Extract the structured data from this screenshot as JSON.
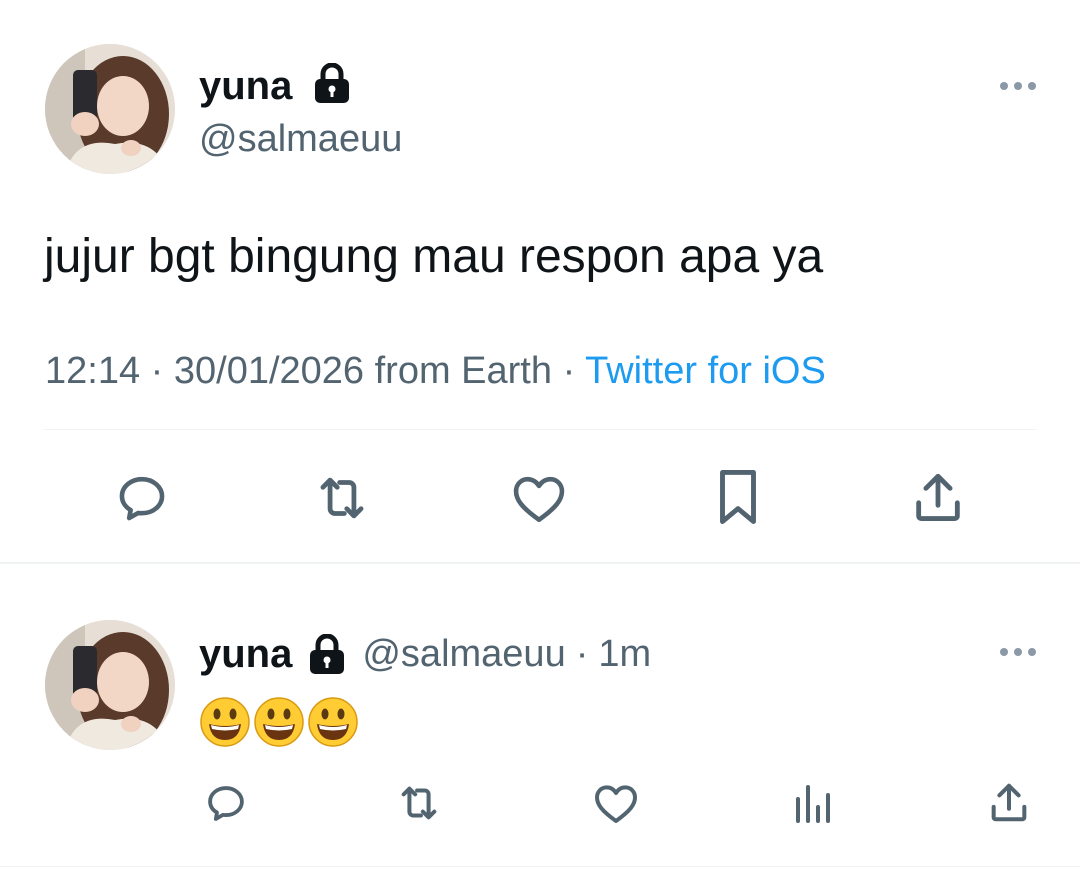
{
  "main_tweet": {
    "author": {
      "display_name": "yuna",
      "handle": "@salmaeuu",
      "locked": true
    },
    "text": "jujur bgt bingung mau respon apa ya",
    "time": "12:14",
    "separator": " · ",
    "date_location": "30/01/2026 from Earth",
    "client": "Twitter for iOS",
    "actions": [
      "reply-icon",
      "retweet-icon",
      "like-icon",
      "bookmark-icon",
      "share-icon"
    ]
  },
  "reply": {
    "author": {
      "display_name": "yuna",
      "handle": "@salmaeuu",
      "locked": true
    },
    "age": "1m",
    "emojis": [
      "😃",
      "😃",
      "😃"
    ],
    "actions": [
      "reply-icon",
      "retweet-icon",
      "like-icon",
      "views-icon",
      "share-icon"
    ]
  },
  "colors": {
    "text_primary": "#0f1419",
    "text_secondary": "#536471",
    "link": "#1d9bf0",
    "divider": "#eff3f4"
  }
}
